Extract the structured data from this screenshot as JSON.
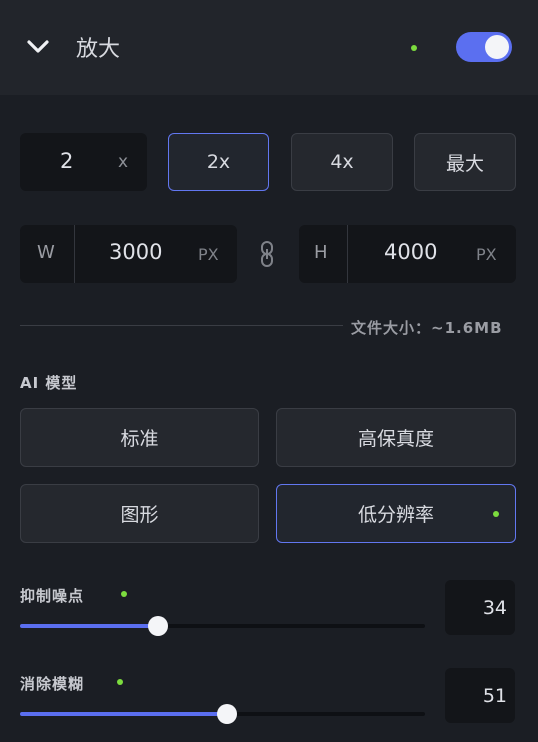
{
  "header": {
    "title": "放大",
    "toggle_on": true,
    "status_dot_color": "#7cdc3e",
    "accent": "#5b6ff0"
  },
  "scale": {
    "custom_value": "2",
    "custom_unit": "x",
    "options": [
      "2x",
      "4x",
      "最大"
    ],
    "selected": "2x"
  },
  "dimensions": {
    "width_label": "W",
    "width_value": "3000",
    "width_unit": "PX",
    "height_label": "H",
    "height_value": "4000",
    "height_unit": "PX",
    "link_icon": "link-icon"
  },
  "file_size": "文件大小：~1.6MB",
  "ai_model": {
    "label": "AI 模型",
    "options": [
      "标准",
      "高保真度",
      "图形",
      "低分辨率"
    ],
    "selected": "低分辨率"
  },
  "sliders": [
    {
      "label": "抑制噪点",
      "value": "34",
      "fraction": 0.34
    },
    {
      "label": "消除模糊",
      "value": "51",
      "fraction": 0.51
    }
  ]
}
